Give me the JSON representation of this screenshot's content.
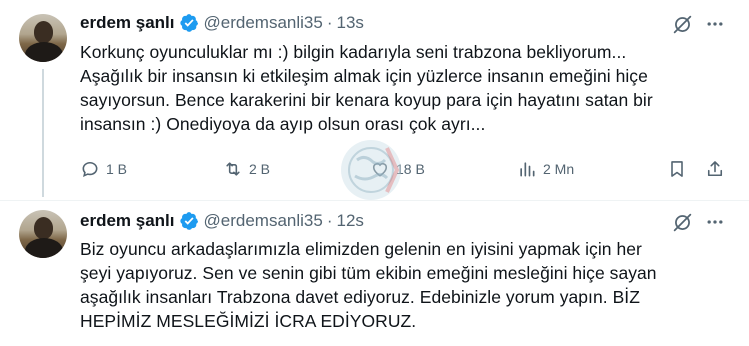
{
  "tweets": [
    {
      "name": "erdem şanlı",
      "handle": "@erdemsanli35",
      "separator": "·",
      "time": "13s",
      "text": "Korkunç oyunculuklar mı :) bilgin kadarıyla seni trabzona bekliyorum...\nAşağılık bir insansın ki etkileşim almak için yüzlerce insanın emeğini hiçe\nsayıyorsun. Bence karakerini bir kenara koyup para için hayatını satan bir\ninsansın :) Onediyoya da ayıp olsun orası çok ayrı...",
      "actions": {
        "reply_count": "1 B",
        "retweet_count": "2 B",
        "like_count": "18 B",
        "views_count": "2 Mn"
      }
    },
    {
      "name": "erdem şanlı",
      "handle": "@erdemsanli35",
      "separator": "·",
      "time": "12s",
      "text": "Biz oyuncu arkadaşlarımızla elimizden gelenin en iyisini yapmak için her\nşeyi yapıyoruz. Sen ve senin gibi tüm ekibin emeğini mesleğini hiçe sayan\naşağılık insanları Trabzona davet ediyoruz. Edebinizle yorum yapın. BİZ\nHEPİMİZ MESLEĞİMİZİ İCRA EDİYORUZ."
    }
  ],
  "icons": {
    "verified": "verified-badge-icon",
    "grok": "grok-icon",
    "more": "more-icon",
    "reply": "reply-icon",
    "retweet": "retweet-icon",
    "like": "heart-icon",
    "views": "views-icon",
    "bookmark": "bookmark-icon",
    "share": "share-icon"
  },
  "colors": {
    "verified": "#1d9bf0",
    "text": "#0f1419",
    "muted": "#536471",
    "thread_line": "#cfd9de"
  }
}
